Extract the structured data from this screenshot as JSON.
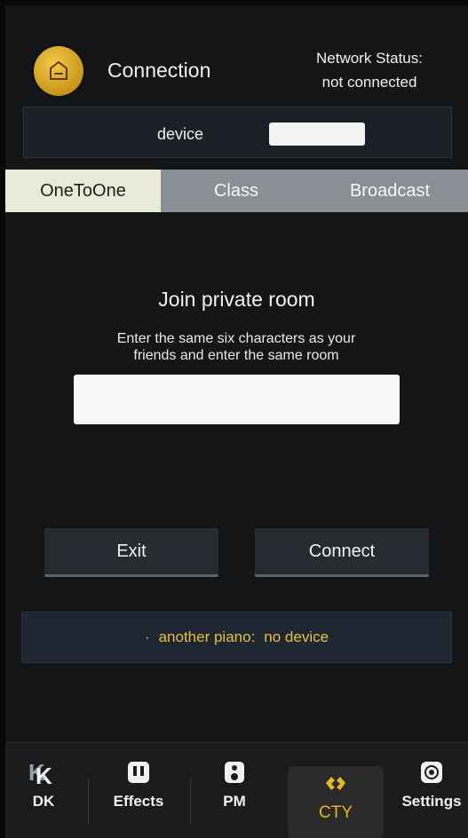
{
  "header": {
    "title": "Connection",
    "network_status_label": "Network Status:",
    "network_status_value": "not connected",
    "device_label": "device"
  },
  "tabs": [
    {
      "label": "OneToOne",
      "active": true
    },
    {
      "label": "Class",
      "active": false
    },
    {
      "label": "Broadcast",
      "active": false
    }
  ],
  "main": {
    "heading": "Join private room",
    "description_line1": "Enter the same six characters as your",
    "description_line2": "friends and enter the same room",
    "room_input_value": ""
  },
  "buttons": {
    "exit": "Exit",
    "connect": "Connect"
  },
  "status": {
    "bullet": "·",
    "label": "another piano:",
    "value": "no device"
  },
  "bottom_nav": [
    {
      "label": "DK",
      "icon": "dk-logo-icon",
      "active": false
    },
    {
      "label": "Effects",
      "icon": "effects-icon",
      "active": false
    },
    {
      "label": "PM",
      "icon": "pm-icon",
      "active": false
    },
    {
      "label": "CTY",
      "icon": "cty-icon",
      "active": true
    },
    {
      "label": "Settings",
      "icon": "settings-icon",
      "active": false
    }
  ],
  "colors": {
    "accent_gold": "#e8b622",
    "status_text": "#e8c13a",
    "active_tab_bg": "#e9ead8",
    "tab_bar_bg": "#8a8f96"
  }
}
